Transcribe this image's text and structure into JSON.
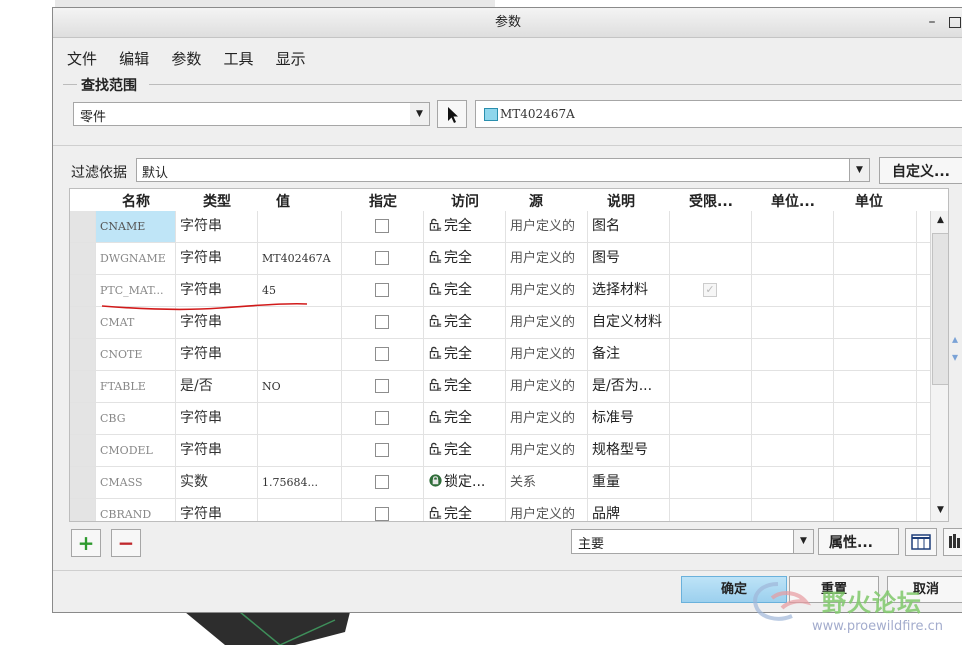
{
  "window": {
    "title": "参数"
  },
  "menu": [
    "文件",
    "编辑",
    "参数",
    "工具",
    "显示"
  ],
  "scope": {
    "group_label": "查找范围",
    "selected": "零件",
    "model_name": "MT402467A"
  },
  "filter": {
    "label": "过滤依据",
    "selected": "默认",
    "custom_button": "自定义..."
  },
  "table": {
    "columns": [
      "名称",
      "类型",
      "值",
      "指定",
      "访问",
      "源",
      "说明",
      "受限...",
      "单位...",
      "单位"
    ],
    "rows": [
      {
        "name": "CNAME",
        "type": "字符串",
        "value": "",
        "designated": false,
        "access": "完全",
        "source": "用户定义的",
        "description": "图名",
        "restricted": "none"
      },
      {
        "name": "DWGNAME",
        "type": "字符串",
        "value": "MT402467A",
        "designated": false,
        "access": "完全",
        "source": "用户定义的",
        "description": "图号",
        "restricted": "none"
      },
      {
        "name": "PTC_MAT...",
        "type": "字符串",
        "value": "45",
        "designated": false,
        "access": "完全",
        "source": "用户定义的",
        "description": "选择材料",
        "restricted": "checked-disabled"
      },
      {
        "name": "CMAT",
        "type": "字符串",
        "value": "",
        "designated": false,
        "access": "完全",
        "source": "用户定义的",
        "description": "自定义材料",
        "restricted": "none"
      },
      {
        "name": "CNOTE",
        "type": "字符串",
        "value": "",
        "designated": false,
        "access": "完全",
        "source": "用户定义的",
        "description": "备注",
        "restricted": "none"
      },
      {
        "name": "FTABLE",
        "type": "是/否",
        "value": "NO",
        "designated": false,
        "access": "完全",
        "source": "用户定义的",
        "description": "是/否为...",
        "restricted": "none"
      },
      {
        "name": "CBG",
        "type": "字符串",
        "value": "",
        "designated": false,
        "access": "完全",
        "source": "用户定义的",
        "description": "标准号",
        "restricted": "none"
      },
      {
        "name": "CMODEL",
        "type": "字符串",
        "value": "",
        "designated": false,
        "access": "完全",
        "source": "用户定义的",
        "description": "规格型号",
        "restricted": "none"
      },
      {
        "name": "CMASS",
        "type": "实数",
        "value": "1.75684...",
        "designated": false,
        "access": "锁定...",
        "source": "关系",
        "description": "重量",
        "restricted": "none"
      },
      {
        "name": "CBRAND",
        "type": "字符串",
        "value": "",
        "designated": false,
        "access": "完全",
        "source": "用户定义的",
        "description": "品牌",
        "restricted": "none"
      }
    ]
  },
  "bottom": {
    "add_symbol": "+",
    "remove_symbol": "−",
    "view_selected": "主要",
    "properties_button": "属性..."
  },
  "footer": {
    "ok": "确定",
    "reset": "重置",
    "cancel": "取消"
  },
  "watermark": {
    "text": "野火论坛",
    "url": "www.proewildfire.cn"
  },
  "colors": {
    "selected_cell": "#bfe5f7",
    "ok_button": "#9cd0ee",
    "add_green": "#2e9a2e",
    "remove_red": "#c0282d",
    "annotation_red": "#d11a1a",
    "watermark_green": "#80c96b"
  },
  "icons": {
    "full_access": "unlock-icon",
    "locked_access": "lock-icon",
    "pick": "cursor-arrow-icon",
    "model": "part-icon"
  }
}
